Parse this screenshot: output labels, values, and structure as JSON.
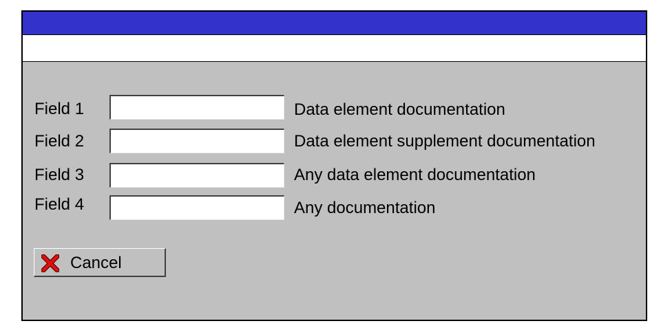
{
  "window": {
    "title": "",
    "colors": {
      "titlebar": "#3333cc",
      "background": "#c0c0c0"
    }
  },
  "form": {
    "fields": [
      {
        "label": "Field 1",
        "value": "",
        "doc": "Data element documentation"
      },
      {
        "label": "Field 2",
        "value": "",
        "doc": "Data element supplement documentation"
      },
      {
        "label": "Field 3",
        "value": "",
        "doc": "Any data element documentation"
      },
      {
        "label": "Field 4",
        "value": "",
        "doc": "Any documentation"
      }
    ]
  },
  "actions": {
    "cancel_label": "Cancel",
    "cancel_icon": "red-x-icon",
    "cancel_icon_color": "#e01010"
  }
}
